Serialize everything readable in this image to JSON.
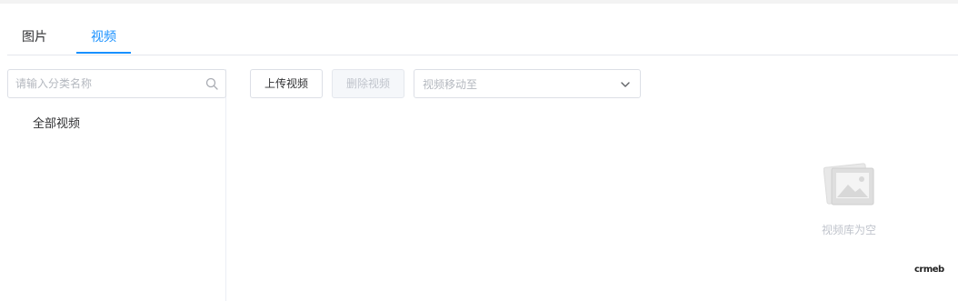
{
  "tabs": [
    {
      "label": "图片",
      "active": false
    },
    {
      "label": "视频",
      "active": true
    }
  ],
  "sidebar": {
    "search": {
      "placeholder": "请输入分类名称",
      "value": "",
      "icon": "search-icon"
    },
    "categories": [
      {
        "label": "全部视频"
      }
    ]
  },
  "toolbar": {
    "upload_label": "上传视频",
    "delete_label": "删除视频",
    "delete_disabled": true,
    "move_select": {
      "placeholder": "视频移动至",
      "icon": "chevron-down-icon"
    }
  },
  "empty_state": {
    "icon": "empty-image-icon",
    "text": "视频库为空"
  },
  "brand": {
    "text": "crmeb"
  },
  "colors": {
    "accent": "#1890ff",
    "border": "#dcdfe6",
    "muted_text": "#c0c4cc"
  }
}
